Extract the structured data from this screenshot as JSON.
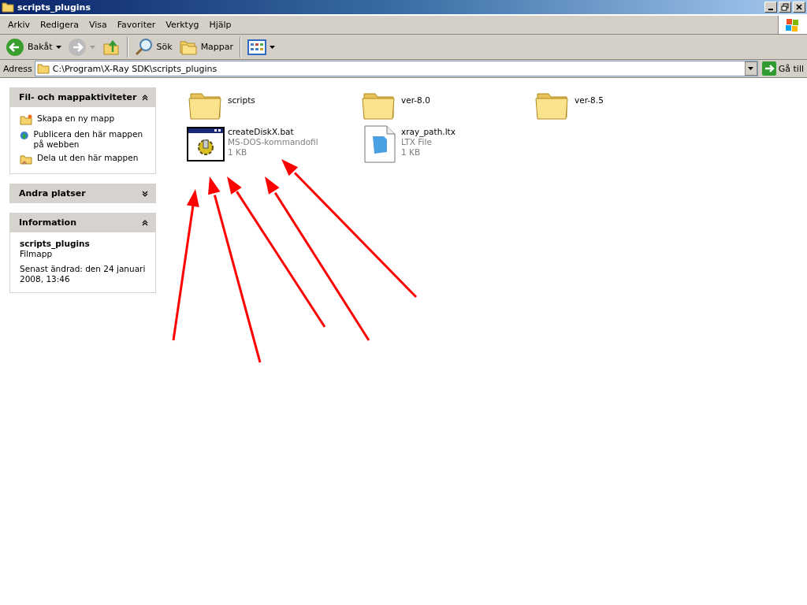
{
  "window": {
    "title": "scripts_plugins"
  },
  "menu": [
    "Arkiv",
    "Redigera",
    "Visa",
    "Favoriter",
    "Verktyg",
    "Hjälp"
  ],
  "toolbar": [
    {
      "kind": "back",
      "label": "Bakåt",
      "disabled": false
    },
    {
      "kind": "forward",
      "disabled": true
    },
    {
      "kind": "up"
    },
    {
      "kind": "sep"
    },
    {
      "kind": "search",
      "label": "Sök"
    },
    {
      "kind": "folders",
      "label": "Mappar"
    },
    {
      "kind": "sep"
    },
    {
      "kind": "views"
    }
  ],
  "address": {
    "label": "Adress",
    "value": "C:\\Program\\X-Ray SDK\\scripts_plugins",
    "go": "Gå till"
  },
  "panels": [
    {
      "title": "Fil- och mappaktiviteter",
      "expanded": true,
      "kind": "tasks",
      "items": [
        {
          "label": "Skapa en ny mapp"
        },
        {
          "label": "Publicera den här mappen på webben"
        },
        {
          "label": "Dela ut den här mappen"
        }
      ]
    },
    {
      "title": "Andra platser",
      "expanded": false
    },
    {
      "title": "Information",
      "expanded": true,
      "kind": "info",
      "name": "scripts_plugins",
      "type": "Filmapp",
      "modified": "Senast ändrad: den 24 januari 2008, 13:46"
    }
  ],
  "files": [
    {
      "kind": "folder",
      "name": "scripts"
    },
    {
      "kind": "folder",
      "name": "ver-8.0"
    },
    {
      "kind": "folder",
      "name": "ver-8.5"
    },
    {
      "kind": "bat",
      "name": "createDiskX.bat",
      "type": "MS-DOS-kommandofil",
      "size": "1 KB"
    },
    {
      "kind": "ltx",
      "name": "xray_path.ltx",
      "type": "LTX File",
      "size": "1 KB"
    }
  ]
}
